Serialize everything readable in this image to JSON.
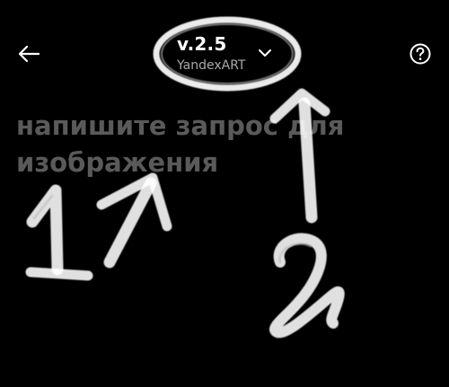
{
  "header": {
    "version": "v.2.5",
    "model_name": "YandexART",
    "back_icon": "arrow-left-icon",
    "help_icon": "question-circle-icon",
    "dropdown_icon": "chevron-down-icon"
  },
  "prompt": {
    "placeholder": "напишите запрос для изображения"
  },
  "annotations": {
    "step_1": "1",
    "step_2": "2",
    "stroke_color": "#ffffff"
  }
}
